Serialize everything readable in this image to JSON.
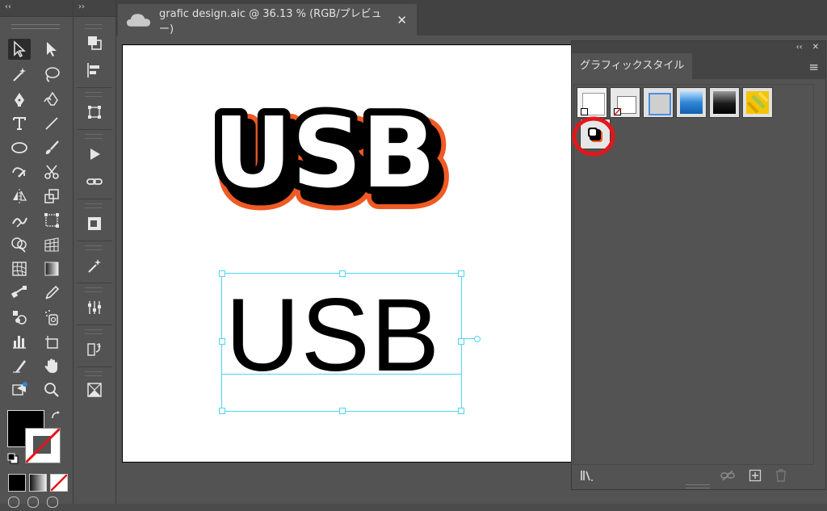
{
  "toolbar": {
    "collapse_label": "‹‹"
  },
  "dock": {
    "expand_label": "››"
  },
  "document": {
    "tab_title": "grafic design.aic @ 36.13 % (RGB/プレビュー)",
    "close_glyph": "✕"
  },
  "artwork": {
    "styled_text": "USB",
    "plain_text": "USB"
  },
  "graphic_styles_panel": {
    "collapse_label": "‹‹",
    "close_glyph": "✕",
    "tab_label": "グラフィックスタイル",
    "menu_glyph": "≡",
    "styles": [
      {
        "name": "default-style"
      },
      {
        "name": "default-text-style"
      },
      {
        "name": "blue-border-style"
      },
      {
        "name": "blue-gradient-style"
      },
      {
        "name": "black-gradient-style"
      },
      {
        "name": "yellow-pattern-style"
      },
      {
        "name": "usb-stroke-shadow-style"
      }
    ]
  },
  "colors": {
    "accent_orange": "#f05a24",
    "highlight_red": "#e3161b",
    "selection_cyan": "#4fd6f0",
    "fill": "#000000",
    "blue_swatch": "#2f86d6"
  }
}
